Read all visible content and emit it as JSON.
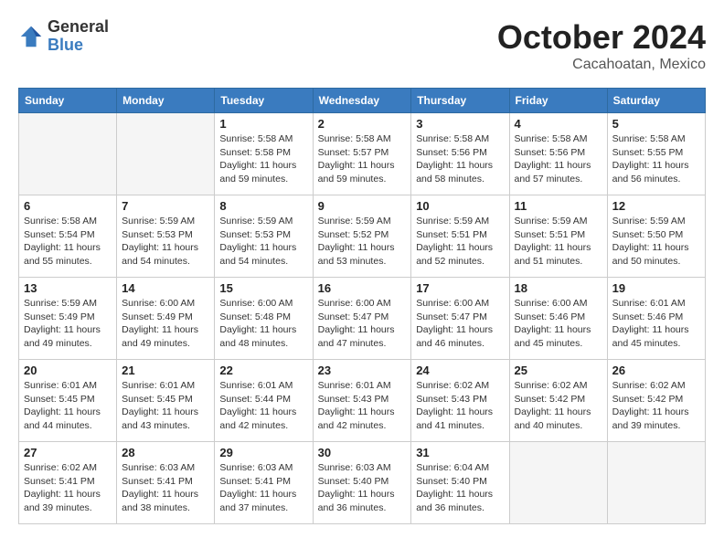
{
  "header": {
    "logo_general": "General",
    "logo_blue": "Blue",
    "month_title": "October 2024",
    "location": "Cacahoatan, Mexico"
  },
  "weekdays": [
    "Sunday",
    "Monday",
    "Tuesday",
    "Wednesday",
    "Thursday",
    "Friday",
    "Saturday"
  ],
  "weeks": [
    [
      {
        "day": "",
        "info": ""
      },
      {
        "day": "",
        "info": ""
      },
      {
        "day": "1",
        "info": "Sunrise: 5:58 AM\nSunset: 5:58 PM\nDaylight: 11 hours and 59 minutes."
      },
      {
        "day": "2",
        "info": "Sunrise: 5:58 AM\nSunset: 5:57 PM\nDaylight: 11 hours and 59 minutes."
      },
      {
        "day": "3",
        "info": "Sunrise: 5:58 AM\nSunset: 5:56 PM\nDaylight: 11 hours and 58 minutes."
      },
      {
        "day": "4",
        "info": "Sunrise: 5:58 AM\nSunset: 5:56 PM\nDaylight: 11 hours and 57 minutes."
      },
      {
        "day": "5",
        "info": "Sunrise: 5:58 AM\nSunset: 5:55 PM\nDaylight: 11 hours and 56 minutes."
      }
    ],
    [
      {
        "day": "6",
        "info": "Sunrise: 5:58 AM\nSunset: 5:54 PM\nDaylight: 11 hours and 55 minutes."
      },
      {
        "day": "7",
        "info": "Sunrise: 5:59 AM\nSunset: 5:53 PM\nDaylight: 11 hours and 54 minutes."
      },
      {
        "day": "8",
        "info": "Sunrise: 5:59 AM\nSunset: 5:53 PM\nDaylight: 11 hours and 54 minutes."
      },
      {
        "day": "9",
        "info": "Sunrise: 5:59 AM\nSunset: 5:52 PM\nDaylight: 11 hours and 53 minutes."
      },
      {
        "day": "10",
        "info": "Sunrise: 5:59 AM\nSunset: 5:51 PM\nDaylight: 11 hours and 52 minutes."
      },
      {
        "day": "11",
        "info": "Sunrise: 5:59 AM\nSunset: 5:51 PM\nDaylight: 11 hours and 51 minutes."
      },
      {
        "day": "12",
        "info": "Sunrise: 5:59 AM\nSunset: 5:50 PM\nDaylight: 11 hours and 50 minutes."
      }
    ],
    [
      {
        "day": "13",
        "info": "Sunrise: 5:59 AM\nSunset: 5:49 PM\nDaylight: 11 hours and 49 minutes."
      },
      {
        "day": "14",
        "info": "Sunrise: 6:00 AM\nSunset: 5:49 PM\nDaylight: 11 hours and 49 minutes."
      },
      {
        "day": "15",
        "info": "Sunrise: 6:00 AM\nSunset: 5:48 PM\nDaylight: 11 hours and 48 minutes."
      },
      {
        "day": "16",
        "info": "Sunrise: 6:00 AM\nSunset: 5:47 PM\nDaylight: 11 hours and 47 minutes."
      },
      {
        "day": "17",
        "info": "Sunrise: 6:00 AM\nSunset: 5:47 PM\nDaylight: 11 hours and 46 minutes."
      },
      {
        "day": "18",
        "info": "Sunrise: 6:00 AM\nSunset: 5:46 PM\nDaylight: 11 hours and 45 minutes."
      },
      {
        "day": "19",
        "info": "Sunrise: 6:01 AM\nSunset: 5:46 PM\nDaylight: 11 hours and 45 minutes."
      }
    ],
    [
      {
        "day": "20",
        "info": "Sunrise: 6:01 AM\nSunset: 5:45 PM\nDaylight: 11 hours and 44 minutes."
      },
      {
        "day": "21",
        "info": "Sunrise: 6:01 AM\nSunset: 5:45 PM\nDaylight: 11 hours and 43 minutes."
      },
      {
        "day": "22",
        "info": "Sunrise: 6:01 AM\nSunset: 5:44 PM\nDaylight: 11 hours and 42 minutes."
      },
      {
        "day": "23",
        "info": "Sunrise: 6:01 AM\nSunset: 5:43 PM\nDaylight: 11 hours and 42 minutes."
      },
      {
        "day": "24",
        "info": "Sunrise: 6:02 AM\nSunset: 5:43 PM\nDaylight: 11 hours and 41 minutes."
      },
      {
        "day": "25",
        "info": "Sunrise: 6:02 AM\nSunset: 5:42 PM\nDaylight: 11 hours and 40 minutes."
      },
      {
        "day": "26",
        "info": "Sunrise: 6:02 AM\nSunset: 5:42 PM\nDaylight: 11 hours and 39 minutes."
      }
    ],
    [
      {
        "day": "27",
        "info": "Sunrise: 6:02 AM\nSunset: 5:41 PM\nDaylight: 11 hours and 39 minutes."
      },
      {
        "day": "28",
        "info": "Sunrise: 6:03 AM\nSunset: 5:41 PM\nDaylight: 11 hours and 38 minutes."
      },
      {
        "day": "29",
        "info": "Sunrise: 6:03 AM\nSunset: 5:41 PM\nDaylight: 11 hours and 37 minutes."
      },
      {
        "day": "30",
        "info": "Sunrise: 6:03 AM\nSunset: 5:40 PM\nDaylight: 11 hours and 36 minutes."
      },
      {
        "day": "31",
        "info": "Sunrise: 6:04 AM\nSunset: 5:40 PM\nDaylight: 11 hours and 36 minutes."
      },
      {
        "day": "",
        "info": ""
      },
      {
        "day": "",
        "info": ""
      }
    ]
  ]
}
